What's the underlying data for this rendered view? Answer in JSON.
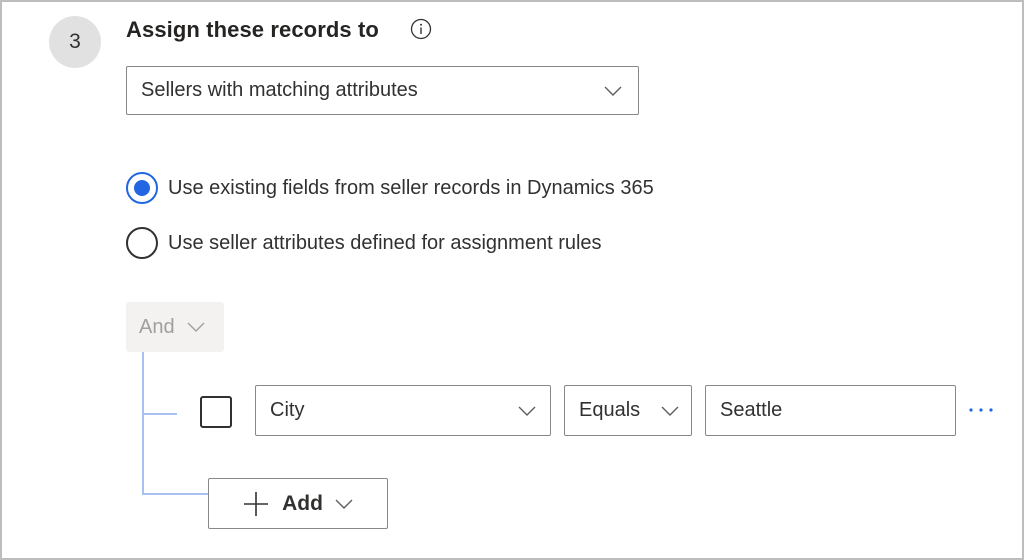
{
  "step": {
    "number": "3",
    "title": "Assign these records to",
    "info_icon": "info-icon"
  },
  "assign_dropdown": {
    "selected": "Sellers with matching attributes",
    "icon": "chevron-down-icon"
  },
  "radio_options": [
    {
      "label": "Use existing fields from seller records in Dynamics 365",
      "checked": true
    },
    {
      "label": "Use seller attributes defined for assignment rules",
      "checked": false
    }
  ],
  "condition_group": {
    "operator": "And",
    "operator_disabled": true,
    "rows": [
      {
        "checked": false,
        "field": "City",
        "comparison": "Equals",
        "value": "Seattle",
        "more_icon": "more-horizontal-icon"
      }
    ],
    "add_button": {
      "label": "Add",
      "icon": "plus-icon"
    }
  },
  "colors": {
    "accent": "#2266e3",
    "tree_line": "#a7c1f0",
    "step_circle": "#e1e1e1",
    "disabled_bg": "#f3f2f1",
    "disabled_text": "#a19f9d",
    "border": "#8a8886"
  }
}
